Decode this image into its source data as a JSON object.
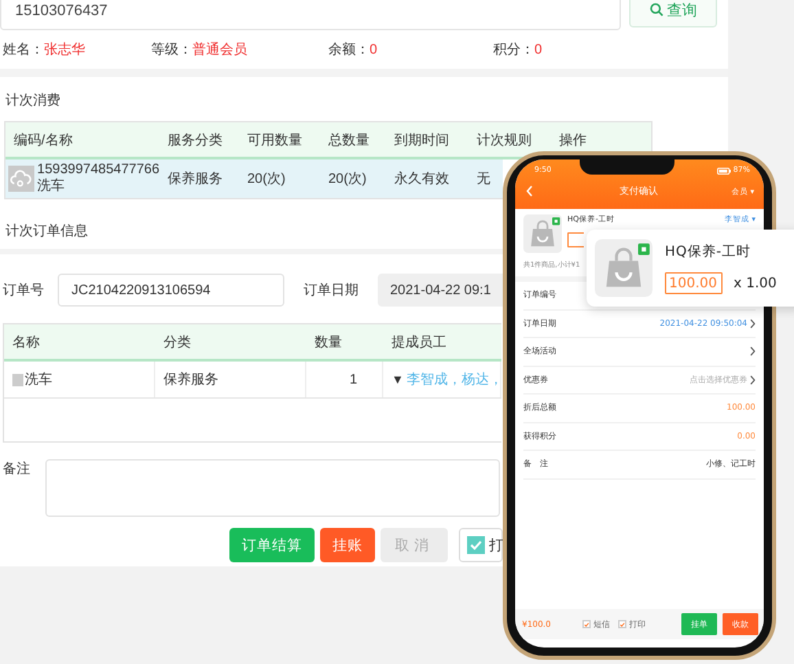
{
  "desktop": {
    "search": {
      "value": "15103076437",
      "button": "查询"
    },
    "member": [
      {
        "label": "姓名：",
        "value": "张志华"
      },
      {
        "label": "等级：",
        "value": "普通会员"
      },
      {
        "label": "余额：",
        "value": "0"
      },
      {
        "label": "积分：",
        "value": "0"
      }
    ],
    "count_section": {
      "title": "计次消费",
      "columns": [
        "编码/名称",
        "服务分类",
        "可用数量",
        "总数量",
        "到期时间",
        "计次规则",
        "操作"
      ],
      "rows": [
        {
          "code": "1593997485477766",
          "name": "洗车",
          "category": "保养服务",
          "available": "20(次)",
          "total": "20(次)",
          "expiry": "永久有效",
          "rule": "无",
          "selected": true
        }
      ]
    },
    "order_section": {
      "title": "计次订单信息",
      "order_no_label": "订单号",
      "order_no": "JC2104220913106594",
      "date_label": "订单日期",
      "date": "2021-04-22 09:1",
      "columns": [
        "名称",
        "分类",
        "数量",
        "提成员工"
      ],
      "rows": [
        {
          "name": "洗车",
          "category": "保养服务",
          "quantity": "1",
          "staff_caret": "▼",
          "staff": "李智成，杨达，"
        }
      ],
      "remark_label": "备注"
    },
    "buttons": [
      {
        "label": "订单结算",
        "kind": "primary"
      },
      {
        "label": "挂账",
        "kind": "warn"
      },
      {
        "label": "取消",
        "kind": "disabled"
      },
      {
        "label": "打",
        "kind": "check",
        "checked": true
      }
    ]
  },
  "phone": {
    "time": "9:50",
    "battery": "87%",
    "title": "支付确认",
    "member_menu": "会员 ▾",
    "product": {
      "name": "HQ保养-工时",
      "staff": "李智成 ▾"
    },
    "summary": "共1件商品,小计¥1",
    "rows": [
      {
        "label": "订单编号",
        "kind": "plain"
      },
      {
        "label": "订单日期",
        "value": "2021-04-22 09:50:04",
        "kind": "link"
      },
      {
        "label": "全场活动",
        "kind": "arrow"
      },
      {
        "label": "优惠券",
        "value": "点击选择优惠券",
        "kind": "hint"
      },
      {
        "label": "折后总额",
        "value": "100.00",
        "kind": "amount"
      },
      {
        "label": "获得积分",
        "value": "0.00",
        "kind": "amount"
      },
      {
        "label": "备　注",
        "value": "小修、记工时",
        "kind": "plain"
      }
    ],
    "footer": {
      "total": "¥100.0",
      "checks": [
        {
          "label": "短信",
          "checked": true
        },
        {
          "label": "打印",
          "checked": true
        }
      ],
      "buttons": [
        {
          "label": "挂单",
          "kind": "primary"
        },
        {
          "label": "收款",
          "kind": "warn"
        }
      ]
    }
  },
  "popup": {
    "name": "HQ保养-工时",
    "price": "100.00",
    "quantity": "x 1.00"
  }
}
